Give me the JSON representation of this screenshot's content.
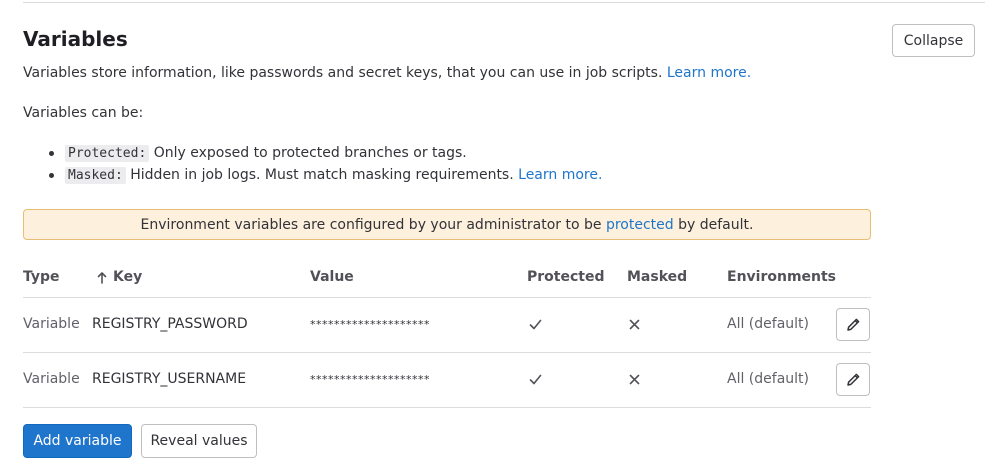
{
  "header": {
    "title": "Variables",
    "collapse_label": "Collapse",
    "description": "Variables store information, like passwords and secret keys, that you can use in job scripts.",
    "learn_more": "Learn more."
  },
  "intro": {
    "can_be": "Variables can be:"
  },
  "bullets": [
    {
      "code": "Protected:",
      "text": "Only exposed to protected branches or tags.",
      "link": ""
    },
    {
      "code": "Masked:",
      "text": "Hidden in job logs. Must match masking requirements.",
      "link": "Learn more."
    }
  ],
  "alert": {
    "before": "Environment variables are configured by your administrator to be",
    "link": "protected",
    "after": "by default.",
    "accent_color": "#fdf1dd"
  },
  "table": {
    "headers": {
      "type": "Type",
      "key": "Key",
      "key_sort_icon": "arrow-up-icon",
      "value": "Value",
      "protected": "Protected",
      "masked": "Masked",
      "environments": "Environments"
    },
    "rows": [
      {
        "type": "Variable",
        "key": "REGISTRY_PASSWORD",
        "value": "********************",
        "protected_icon": "check-icon",
        "masked_icon": "close-icon",
        "environment": "All (default)",
        "edit_icon": "pencil-icon"
      },
      {
        "type": "Variable",
        "key": "REGISTRY_USERNAME",
        "value": "********************",
        "protected_icon": "check-icon",
        "masked_icon": "close-icon",
        "environment": "All (default)",
        "edit_icon": "pencil-icon"
      }
    ]
  },
  "actions": {
    "add_variable": "Add variable",
    "reveal_values": "Reveal values",
    "primary_color": "#1f75cb"
  }
}
